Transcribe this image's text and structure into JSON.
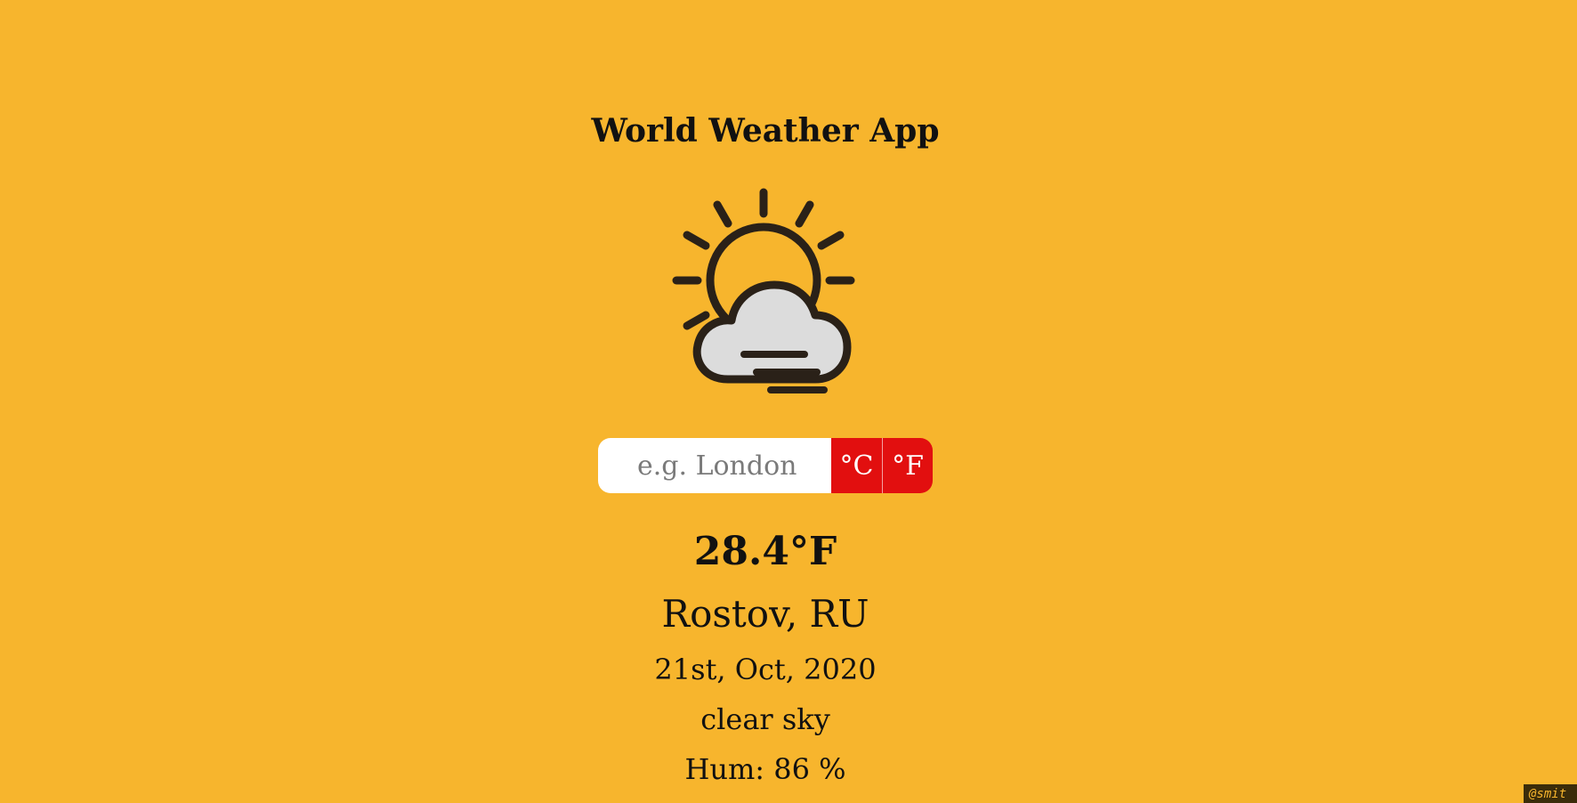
{
  "app": {
    "title": "World Weather App"
  },
  "search": {
    "placeholder": "e.g. London",
    "value": ""
  },
  "units": {
    "celsius_label": "°C",
    "fahrenheit_label": "°F"
  },
  "weather": {
    "icon": "sun-behind-cloud-icon",
    "temperature": "28.4°F",
    "location": "Rostov, RU",
    "date": "21st, Oct, 2020",
    "description": "clear sky",
    "humidity": "Hum: 86 %"
  },
  "credit": {
    "text": "@smit"
  },
  "colors": {
    "background": "#f7b52d",
    "accent": "#e20f0f",
    "text": "#111111"
  }
}
